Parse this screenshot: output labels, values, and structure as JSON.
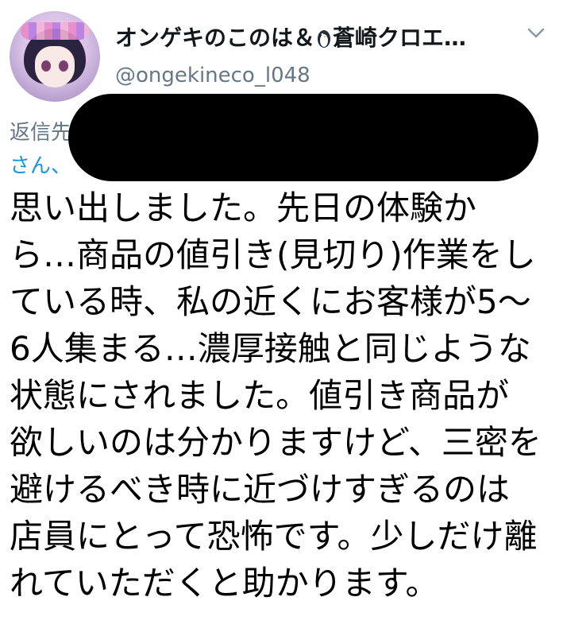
{
  "tweet": {
    "display_name": "オンゲキのこのは＆",
    "display_name_suffix": "蒼崎クロエ…",
    "handle": "@ongekineco_l048",
    "reply_label": "返信先",
    "reply_mention": "さん、",
    "body": "思い出しました。先日の体験から…商品の値引き(見切り)作業をしている時、私の近くにお客様が5〜6人集まる…濃厚接触と同じような状態にされました。値引き商品が欲しいのは分かりますけど、三密を避けるべき時に近づけすぎるのは店員にとって恐怖です。少しだけ離れていただくと助かります。"
  },
  "icons": {
    "name_emoji": "penguin-icon",
    "menu": "chevron-down-icon"
  },
  "colors": {
    "link": "#1b95e0",
    "secondary_text": "#657786",
    "redaction": "#000000"
  }
}
